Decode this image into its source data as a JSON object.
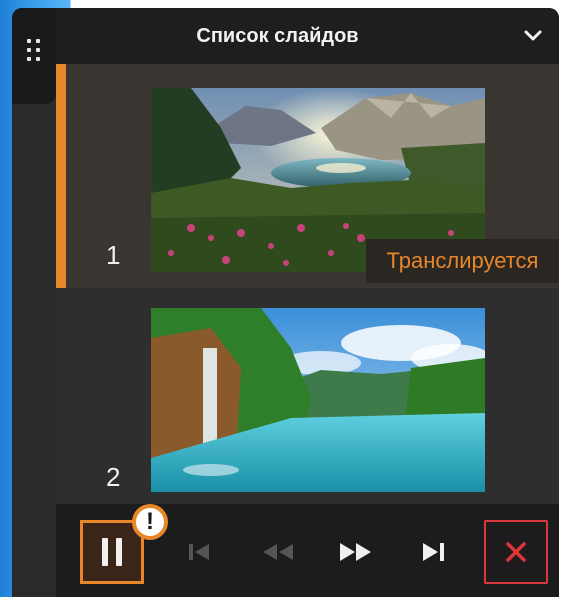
{
  "panel": {
    "title": "Список слайдов"
  },
  "slides": [
    {
      "number": "1",
      "status": "Транслируется",
      "active": true
    },
    {
      "number": "2",
      "active": false
    }
  ],
  "controls": {
    "alert_mark": "!",
    "buttons": [
      "pause",
      "first-slide",
      "rewind",
      "fast-forward",
      "last-slide",
      "close"
    ]
  },
  "colors": {
    "accent": "#e8862a",
    "danger": "#d9363e",
    "panel_bg": "#2b2b2b",
    "header_bg": "#1e1e1e"
  },
  "icons": {
    "grip": "grip-dots-icon",
    "collapse": "chevron-down-icon",
    "pause": "pause-icon",
    "first": "skip-to-start-icon",
    "rewind": "rewind-icon",
    "forward": "fast-forward-icon",
    "last": "skip-to-end-icon",
    "close": "close-icon",
    "alert": "alert-icon"
  }
}
